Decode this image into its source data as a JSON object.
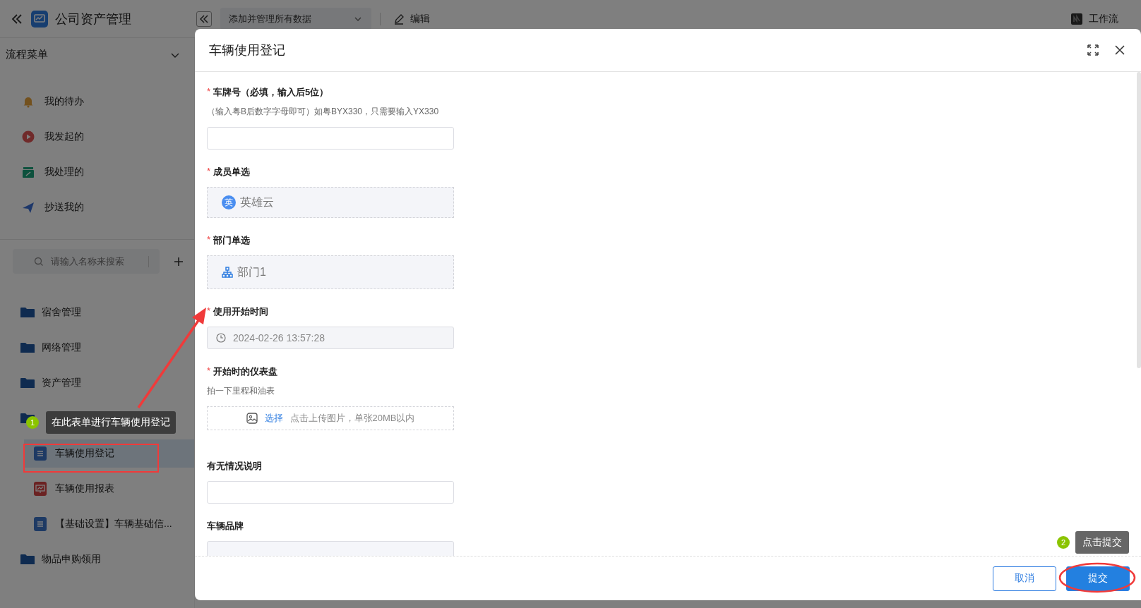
{
  "app": {
    "title": "公司资产管理"
  },
  "toolbar": {
    "view_select": "添加并管理所有数据",
    "edit": "编辑",
    "workflow": "工作流"
  },
  "sidebar": {
    "section": "流程菜单",
    "flow_items": [
      {
        "label": "我的待办",
        "kind": "bell"
      },
      {
        "label": "我发起的",
        "kind": "play"
      },
      {
        "label": "我处理的",
        "kind": "tray"
      },
      {
        "label": "抄送我的",
        "kind": "send"
      }
    ],
    "search": {
      "placeholder": "请输入名称来搜索"
    },
    "tree": [
      {
        "label": "宿舍管理",
        "kind": "folder"
      },
      {
        "label": "网络管理",
        "kind": "folder"
      },
      {
        "label": "资产管理",
        "kind": "folder"
      },
      {
        "kind": "folder",
        "children": [
          {
            "label": "车辆使用登记",
            "kind": "form",
            "selected": true
          },
          {
            "label": "车辆使用报表",
            "kind": "report",
            "selected": false
          },
          {
            "label": "【基础设置】车辆基础信...",
            "kind": "form",
            "selected": false
          }
        ]
      },
      {
        "label": "物品申购领用",
        "kind": "folder"
      }
    ]
  },
  "dialog": {
    "title": "车辆使用登记",
    "fields": [
      {
        "kind": "text",
        "label": "车牌号（必填，输入后5位）",
        "required_mark": "*",
        "hint": "（输入粤B后数字字母即可）如粤BYX330，只需要输入YX330"
      },
      {
        "kind": "member",
        "label": "成员单选",
        "required_mark": "*",
        "avatar": "英",
        "value": "英雄云"
      },
      {
        "kind": "department",
        "label": "部门单选",
        "required_mark": "*",
        "value": "部门1"
      },
      {
        "kind": "datetime",
        "label": "使用开始时间",
        "required_mark": "*",
        "value": "2024-02-26 13:57:28"
      },
      {
        "kind": "image",
        "label": "开始时的仪表盘",
        "required_mark": "*",
        "hint": "拍一下里程和油表",
        "action": "选择",
        "tip": "点击上传图片，单张20MB以内"
      },
      {
        "kind": "text",
        "label": "有无情况说明"
      },
      {
        "kind": "readonly",
        "label": "车辆品牌"
      }
    ],
    "buttons": [
      {
        "label": "取消",
        "kind": "secondary"
      },
      {
        "label": "提交",
        "kind": "primary"
      }
    ]
  },
  "annotations": [
    {
      "number": "1",
      "text": "在此表单进行车辆使用登记"
    },
    {
      "number": "2",
      "text": "点击提交"
    }
  ]
}
